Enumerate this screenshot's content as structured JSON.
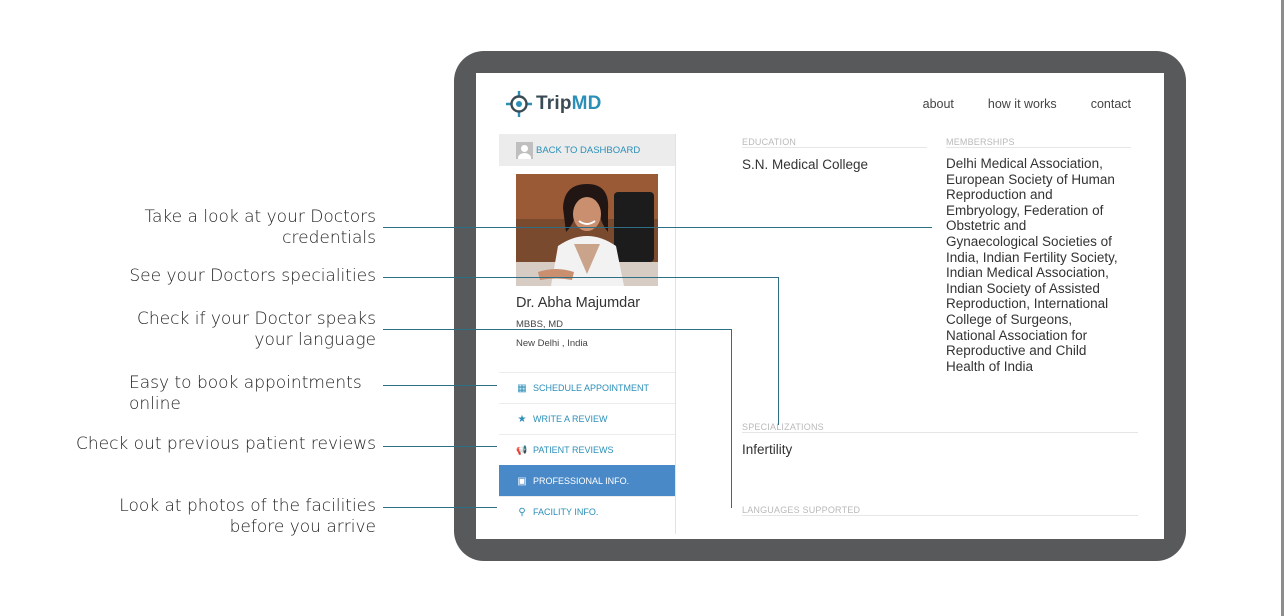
{
  "callouts": {
    "credentials": "Take a look at your Doctors credentials",
    "credentials_l1": "Take a look at your Doctors",
    "credentials_l2": "credentials",
    "specialities": "See your Doctors specialities",
    "language_l1": "Check if your Doctor speaks",
    "language_l2": "your language",
    "appointments_l1": "Easy to book appointments",
    "appointments_l2": "online",
    "reviews": "Check out previous patient reviews",
    "facilities_l1": "Look at photos of the facilities",
    "facilities_l2": "before you arrive"
  },
  "brand": {
    "name_part1": "Trip",
    "name_part2": "MD",
    "accent": "#2b8fb8",
    "dark": "#3b4b56"
  },
  "nav": [
    "about",
    "how it works",
    "contact"
  ],
  "sidebar": {
    "back_label": "BACK TO DASHBOARD",
    "doctor_name": "Dr. Abha Majumdar",
    "degree": "MBBS, MD",
    "location": "New Delhi , India",
    "menu": [
      {
        "label": "SCHEDULE APPOINTMENT",
        "icon": "calendar-icon",
        "glyph": "▦",
        "active": false
      },
      {
        "label": "WRITE A REVIEW",
        "icon": "star-icon",
        "glyph": "★",
        "active": false
      },
      {
        "label": "PATIENT REVIEWS",
        "icon": "megaphone-icon",
        "glyph": "📢",
        "active": false
      },
      {
        "label": "PROFESSIONAL INFO.",
        "icon": "briefcase-icon",
        "glyph": "▣",
        "active": true
      },
      {
        "label": "FACILITY INFO.",
        "icon": "map-pin-icon",
        "glyph": "⚲",
        "active": false
      }
    ],
    "active_color": "#4a89c8"
  },
  "profile": {
    "education_label": "EDUCATION",
    "education": "S.N. Medical College",
    "memberships_label": "MEMBERSHIPS",
    "memberships_lines": [
      "Delhi Medical Association,",
      "European Society of Human",
      "Reproduction and",
      "Embryology, Federation of",
      "Obstetric and",
      "Gynaecological Societies of",
      "India, Indian Fertility Society,",
      "Indian Medical Association,",
      "Indian Society of Assisted",
      "Reproduction, International",
      "College of Surgeons,",
      "National Association for",
      "Reproductive and Child",
      "Health of India"
    ],
    "specializations_label": "SPECIALIZATIONS",
    "specializations": "Infertility",
    "languages_label": "LANGUAGES SUPPORTED"
  }
}
